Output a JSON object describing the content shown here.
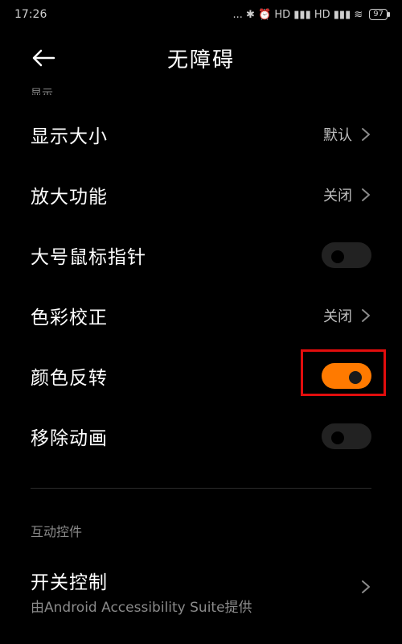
{
  "status_bar": {
    "time": "17:26",
    "indicators": "... ✱ ⏰ HD ▮▮▮ HD ▮▮▮ ≋",
    "battery": "97"
  },
  "header": {
    "title": "无障碍"
  },
  "clipped_section_label": "显示",
  "rows": [
    {
      "label": "显示大小",
      "value": "默认"
    },
    {
      "label": "放大功能",
      "value": "关闭"
    },
    {
      "label": "大号鼠标指针",
      "toggle": false
    },
    {
      "label": "色彩校正",
      "value": "关闭"
    },
    {
      "label": "颜色反转",
      "toggle": true
    },
    {
      "label": "移除动画",
      "toggle": false
    }
  ],
  "section": {
    "title": "互动控件"
  },
  "switch_control": {
    "label": "开关控制",
    "subtitle": "由Android Accessibility Suite提供"
  },
  "colors": {
    "accent": "#ff7a00",
    "highlight": "#e20d0d"
  }
}
